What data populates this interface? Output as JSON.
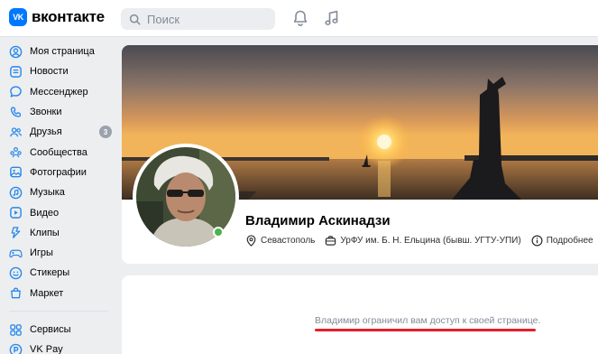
{
  "header": {
    "logo_text": "вконтакте",
    "logo_mark": "VK",
    "search_placeholder": "Поиск"
  },
  "sidebar": {
    "items": [
      {
        "label": "Моя страница",
        "icon": "user-circle-icon"
      },
      {
        "label": "Новости",
        "icon": "news-icon"
      },
      {
        "label": "Мессенджер",
        "icon": "message-icon"
      },
      {
        "label": "Звонки",
        "icon": "phone-icon"
      },
      {
        "label": "Друзья",
        "icon": "friends-icon",
        "badge": "3"
      },
      {
        "label": "Сообщества",
        "icon": "communities-icon"
      },
      {
        "label": "Фотографии",
        "icon": "photos-icon"
      },
      {
        "label": "Музыка",
        "icon": "music-icon"
      },
      {
        "label": "Видео",
        "icon": "video-icon"
      },
      {
        "label": "Клипы",
        "icon": "clips-icon"
      },
      {
        "label": "Игры",
        "icon": "games-icon"
      },
      {
        "label": "Стикеры",
        "icon": "stickers-icon"
      },
      {
        "label": "Маркет",
        "icon": "market-icon"
      }
    ],
    "secondary_items": [
      {
        "label": "Сервисы",
        "icon": "services-icon"
      },
      {
        "label": "VK Pay",
        "icon": "vkpay-icon"
      }
    ]
  },
  "profile": {
    "name": "Владимир Аскинадзи",
    "city": "Севастополь",
    "university": "УрФУ им. Б. Н. Ельцина (бывш. УГТУ-УПИ)",
    "more": "Подробнее",
    "online": true
  },
  "restricted": {
    "message": "Владимир ограничил вам доступ к своей странице."
  },
  "colors": {
    "accent": "#0077ff",
    "nav_icon": "#2688eb",
    "underline": "#e3202b",
    "online": "#4bb34b"
  }
}
